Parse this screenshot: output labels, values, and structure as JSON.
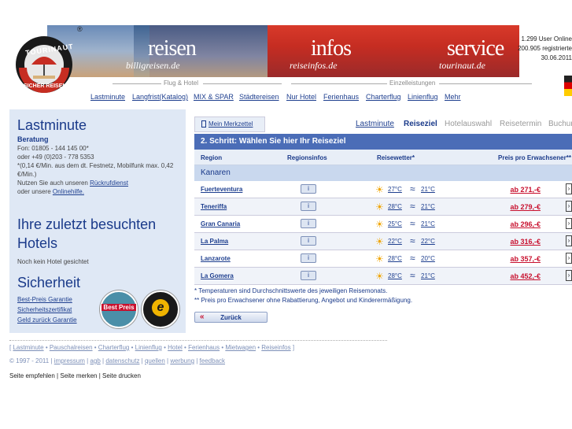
{
  "header": {
    "brands": [
      {
        "title": "reisen",
        "domain": "billigreisen.de"
      },
      {
        "title": "infos",
        "domain": "reiseinfos.de"
      },
      {
        "title": "service",
        "domain": "tourinaut.de"
      }
    ],
    "logo": {
      "top": "TOURINAUT",
      "bottom": "SICHER REISEN",
      "mark": "®"
    },
    "nav_group_left": "Flug & Hotel",
    "nav_group_right": "Einzelleistungen",
    "nav_items": [
      "Lastminute",
      "Langfrist(Katalog)",
      "MIX & SPAR",
      "Städtereisen",
      "Nur Hotel",
      "Ferienhaus",
      "Charterflug",
      "Linienflug",
      "Mehr"
    ],
    "user_stats": [
      "1.299 User Online",
      "200.905 registrierte",
      "30.06.2011"
    ]
  },
  "sidebar": {
    "lastminute": {
      "title": "Lastminute",
      "subtitle": "Beratung",
      "lines": [
        "Fon: 01805 - 144 145 00*",
        "oder +49 (0)203 - 778 5353",
        "*(0,14 €/Min. aus dem dt. Festnetz, Mobilfunk max. 0,42 €/Min.)"
      ],
      "rueckruf_prefix": "Nutzen Sie auch unseren ",
      "rueckruf_link": "Rückrufdienst",
      "online_prefix": "oder unsere ",
      "online_link": "Onlinehilfe."
    },
    "hotels": {
      "title": "Ihre zuletzt besuchten Hotels",
      "empty": "Noch kein Hotel gesichtet"
    },
    "security": {
      "title": "Sicherheit",
      "links": [
        "Best-Preis Garantie",
        "Sicherheitszertifikat",
        "Geld zurück Garantie"
      ],
      "badge1": "Best Preis",
      "badge2": "e"
    }
  },
  "main": {
    "merkzettel": "Mein Merkzettel",
    "steps": [
      {
        "label": "Lastminute",
        "state": "link"
      },
      {
        "label": "Reiseziel",
        "state": "active"
      },
      {
        "label": "Hotelauswahl",
        "state": "inactive"
      },
      {
        "label": "Reisetermin",
        "state": "inactive"
      },
      {
        "label": "Buchung",
        "state": "inactive"
      }
    ],
    "step_title": "2. Schritt: Wählen Sie hier Ihr Reiseziel",
    "table": {
      "headers": [
        "Region",
        "Regionsinfos",
        "Reisewetter*",
        "Preis pro Erwachsener**"
      ],
      "group": "Kanaren",
      "rows": [
        {
          "region": "Fuerteventura",
          "air": "27°C",
          "water": "21°C",
          "price": "ab 271,-€"
        },
        {
          "region": "Teneriffa",
          "air": "28°C",
          "water": "21°C",
          "price": "ab 279,-€"
        },
        {
          "region": "Gran Canaria",
          "air": "25°C",
          "water": "21°C",
          "price": "ab 296,-€"
        },
        {
          "region": "La Palma",
          "air": "22°C",
          "water": "22°C",
          "price": "ab 316,-€"
        },
        {
          "region": "Lanzarote",
          "air": "28°C",
          "water": "20°C",
          "price": "ab 357,-€"
        },
        {
          "region": "La Gomera",
          "air": "28°C",
          "water": "21°C",
          "price": "ab 452,-€"
        }
      ],
      "info_label": "i"
    },
    "notes": [
      "* Temperaturen sind Durchschnittswerte des jeweiligen Reisemonats.",
      "** Preis pro Erwachsener ohne Rabattierung, Angebot und Kinderermäßigung."
    ],
    "back_label": "Zurück"
  },
  "footer": {
    "links": [
      "Lastminute",
      "Pauschalreisen",
      "Charterflug",
      "Linienflug",
      "Hotel",
      "Ferienhaus",
      "Mietwagen",
      "Reiseinfos"
    ],
    "copyright": "© 1997 - 2011 |",
    "legal": [
      "impressum",
      "agb",
      "datenschutz",
      "quellen",
      "werbung",
      "feedback"
    ],
    "actions": [
      "Seite empfehlen",
      "Seite merken",
      "Seite drucken"
    ]
  },
  "colors": {
    "brand_blue": "#1a3a8a",
    "step_bar": "#4b6db7",
    "price_red": "#c8102e",
    "sidebar_bg": "#dfe8f5"
  }
}
